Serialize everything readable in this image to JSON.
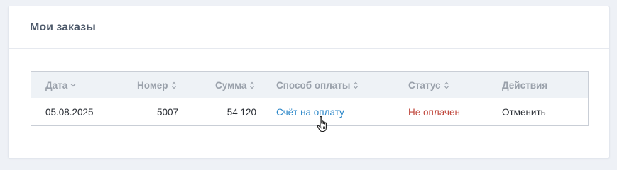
{
  "page": {
    "title": "Мои заказы"
  },
  "table": {
    "headers": {
      "date": "Дата",
      "number": "Номер",
      "sum": "Сумма",
      "payment": "Способ оплаты",
      "status": "Статус",
      "actions": "Действия"
    },
    "rows": [
      {
        "date": "05.08.2025",
        "number": "5007",
        "sum": "54 120",
        "payment": "Счёт на оплату",
        "status": "Не оплачен",
        "action": "Отменить"
      }
    ]
  },
  "colors": {
    "link": "#2a86c8",
    "status_unpaid": "#c0473c",
    "header_bg": "#eef2f6"
  },
  "icons": {
    "sort_active": "chevron-down-icon",
    "sort_both": "sort-updown-icon",
    "cursor": "hand-pointer-icon"
  }
}
